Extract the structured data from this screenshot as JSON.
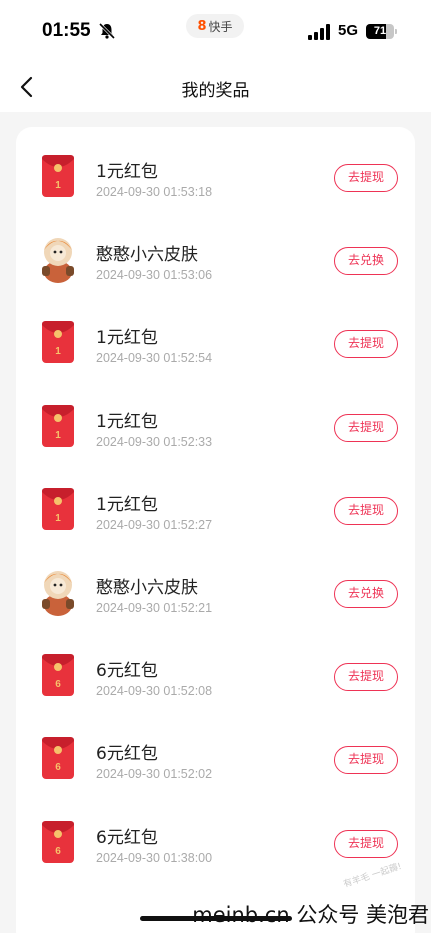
{
  "status_bar": {
    "time": "01:55",
    "app_name": "快手",
    "app_logo": "8",
    "network": "5G",
    "battery_level": "71",
    "battery_fraction": 0.71
  },
  "header": {
    "back_icon": "chevron-left-icon",
    "title": "我的奖品"
  },
  "prizes": [
    {
      "type": "red-envelope",
      "envelope_mark": "1",
      "name": "1元红包",
      "time": "2024-09-30 01:53:18",
      "action": "去提现"
    },
    {
      "type": "avatar-skin",
      "name": "憨憨小六皮肤",
      "time": "2024-09-30 01:53:06",
      "action": "去兑换"
    },
    {
      "type": "red-envelope",
      "envelope_mark": "1",
      "name": "1元红包",
      "time": "2024-09-30 01:52:54",
      "action": "去提现"
    },
    {
      "type": "red-envelope",
      "envelope_mark": "1",
      "name": "1元红包",
      "time": "2024-09-30 01:52:33",
      "action": "去提现"
    },
    {
      "type": "red-envelope",
      "envelope_mark": "1",
      "name": "1元红包",
      "time": "2024-09-30 01:52:27",
      "action": "去提现"
    },
    {
      "type": "avatar-skin",
      "name": "憨憨小六皮肤",
      "time": "2024-09-30 01:52:21",
      "action": "去兑换"
    },
    {
      "type": "red-envelope",
      "envelope_mark": "6",
      "name": "6元红包",
      "time": "2024-09-30 01:52:08",
      "action": "去提现"
    },
    {
      "type": "red-envelope",
      "envelope_mark": "6",
      "name": "6元红包",
      "time": "2024-09-30 01:52:02",
      "action": "去提现"
    },
    {
      "type": "red-envelope",
      "envelope_mark": "6",
      "name": "6元红包",
      "time": "2024-09-30 01:38:00",
      "action": "去提现"
    }
  ],
  "watermark": "meinb.cn 公众号 美泡君",
  "faint_watermark": "有羊毛 一起薅!",
  "colors": {
    "accent": "#ee3355",
    "envelope_red": "#e8323c",
    "envelope_gold": "#f6c26b",
    "page_background": "#f5f5f5"
  }
}
